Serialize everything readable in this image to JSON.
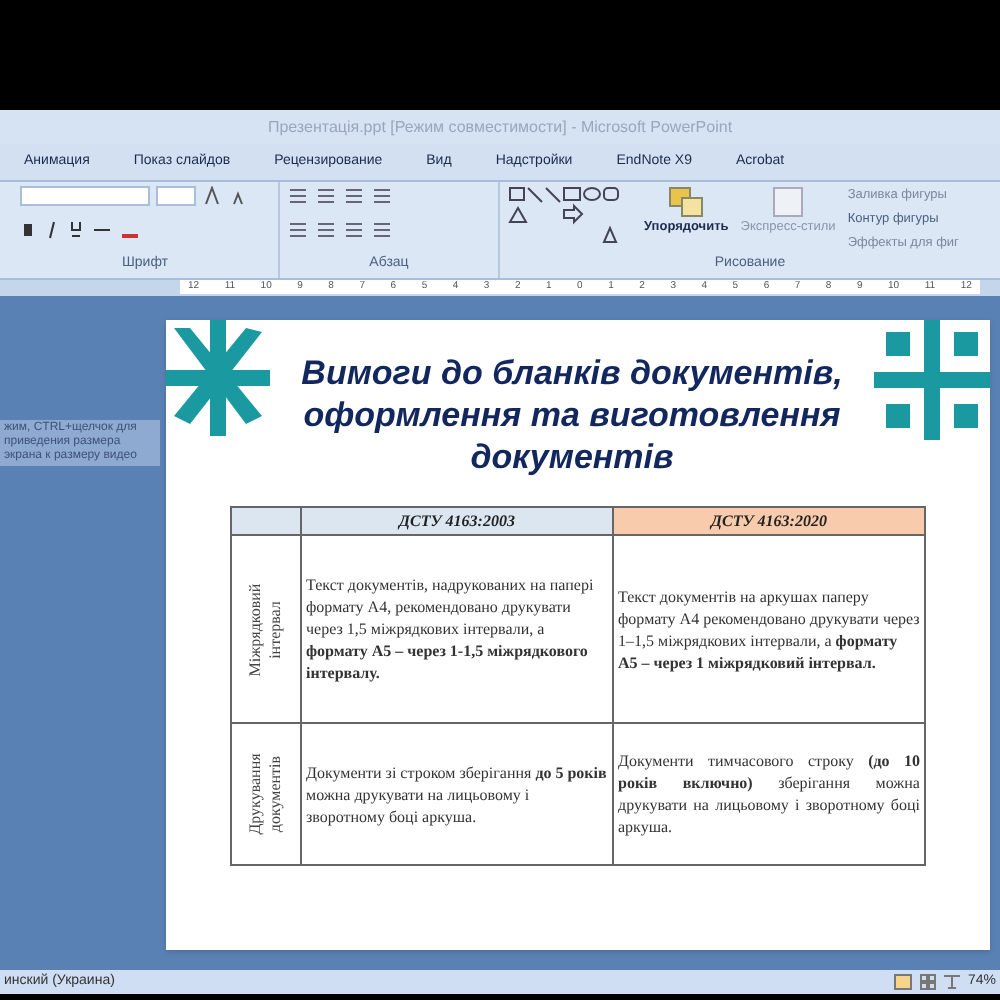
{
  "window": {
    "title": "Презентація.ppt [Режим совместимости] - Microsoft PowerPoint"
  },
  "tabs": [
    {
      "label": "Анимация",
      "selected": false
    },
    {
      "label": "Показ слайдов",
      "selected": false
    },
    {
      "label": "Рецензирование",
      "selected": false
    },
    {
      "label": "Вид",
      "selected": false
    },
    {
      "label": "Надстройки",
      "selected": false
    },
    {
      "label": "EndNote X9",
      "selected": false
    },
    {
      "label": "Acrobat",
      "selected": false
    }
  ],
  "ribbon": {
    "groups": [
      {
        "kind": "font",
        "label": "Шрифт"
      },
      {
        "kind": "paragraph",
        "label": "Абзац"
      },
      {
        "kind": "drawing",
        "label": "Рисование",
        "arrange": "Упорядочить",
        "quick_styles": "Экспресс-стили",
        "shape_fill": "Заливка фигуры",
        "shape_outline": "Контур фигуры",
        "shape_effects": "Эффекты для фиг"
      }
    ]
  },
  "ruler": [
    "12",
    "11",
    "10",
    "9",
    "8",
    "7",
    "6",
    "5",
    "4",
    "3",
    "2",
    "1",
    "0",
    "1",
    "2",
    "3",
    "4",
    "5",
    "6",
    "7",
    "8",
    "9",
    "10",
    "11",
    "12"
  ],
  "overlay_hint": "жим, CTRL+щелчок для приведения размера экрана к размеру видео",
  "slide": {
    "title": "Вимоги до бланків документів, оформлення та виготовлення документів",
    "table": {
      "columns": [
        {
          "label": "ДСТУ 4163:2003",
          "color": "#dce6f1"
        },
        {
          "label": "ДСТУ 4163:2020",
          "color": "#f8cbad"
        }
      ],
      "rows": [
        {
          "header": "Міжрядковий інтервал",
          "cells": [
            "Текст документів, надрукованих на папері формату А4, рекомендовано друкувати через 1,5 міжрядкових інтервали, а **формату А5 – через 1-1,5 міжрядкового інтервалу.**",
            "Текст документів на аркушах паперу формату А4 рекомендовано друкувати через 1–1,5 міжрядкових інтервали, а **формату А5 – через 1 міжрядковий інтервал.**"
          ]
        },
        {
          "header": "Друкування документів",
          "cells": [
            "Документи зі строком зберігання **до 5 років** можна друкувати на лицьовому і зворотному боці аркуша.",
            "Документи тимчасового строку **(до 10 років включно)** зберігання можна друкувати на лицьовому і зворотному боці аркуша."
          ]
        }
      ]
    }
  },
  "status_bar": {
    "language": "инский (Украина)",
    "zoom": "74%"
  }
}
